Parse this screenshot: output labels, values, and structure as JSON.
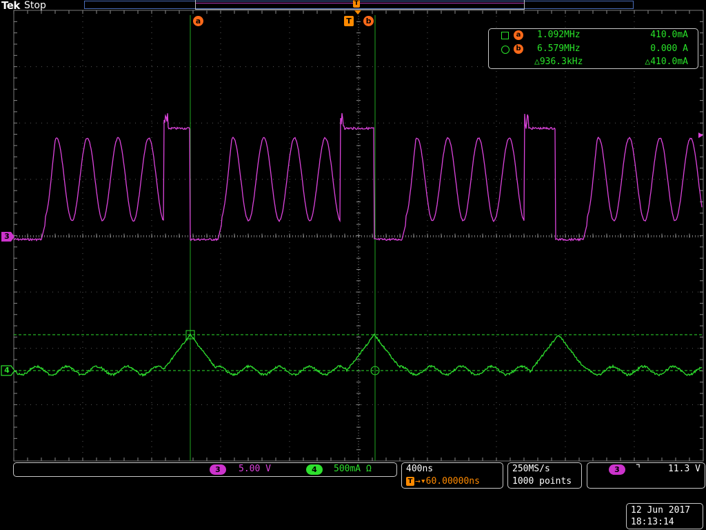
{
  "header": {
    "brand": "Tek",
    "acquisition_status": "Stop"
  },
  "markers": {
    "cursor_a_label": "a",
    "cursor_b_label": "b",
    "trigger_label": "T",
    "trigger_top_label": "T"
  },
  "measurements": {
    "row_a": {
      "marker": "a",
      "frequency": "1.092MHz",
      "amplitude": "410.0mA"
    },
    "row_b": {
      "marker": "b",
      "frequency": "6.579MHz",
      "amplitude": "0.000 A"
    },
    "delta": {
      "frequency": "△936.3kHz",
      "amplitude": "△410.0mA"
    }
  },
  "channels": {
    "ch3": {
      "number": "3",
      "scale": "5.00 V",
      "color": "#cc33cc"
    },
    "ch4": {
      "number": "4",
      "scale": "500mA Ω",
      "color": "#33cc33"
    }
  },
  "timebase": {
    "scale": "400ns",
    "trigger_position": "→▾60.00000ns",
    "trigger_icon": "T"
  },
  "acquisition": {
    "sample_rate": "250MS/s",
    "record_length": "1000 points"
  },
  "trigger": {
    "source": "3",
    "slope_icon": "falling-edge-icon",
    "slope_glyph": "⌝",
    "level": "11.3 V"
  },
  "datetime": {
    "date": "12 Jun 2017",
    "time": "18:13:14"
  },
  "colors": {
    "ch3": "#dd44dd",
    "ch4": "#2ee02e",
    "cursor": "#1fa81f",
    "marker": "#ff6a1a",
    "trigger": "#ff8a00",
    "grid": "#6a6a6a"
  }
}
